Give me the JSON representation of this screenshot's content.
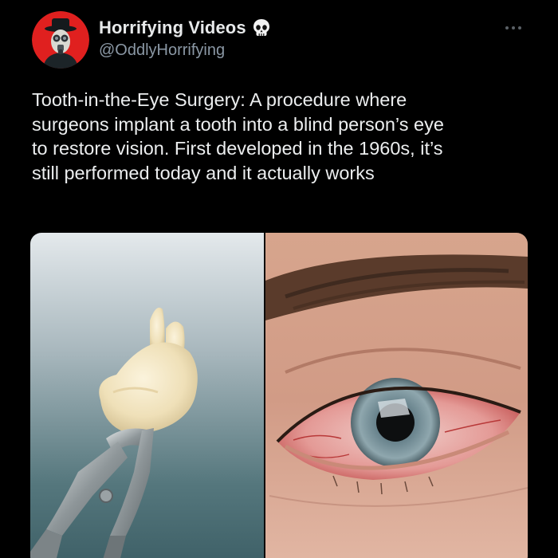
{
  "account": {
    "display_name": "Horrifying Videos",
    "handle": "@OddlyHorrifying",
    "badge_icon": "skull-icon",
    "avatar_icon": "masked-figure-avatar"
  },
  "post": {
    "text": "Tooth-in-the-Eye Surgery: A procedure where\nsurgeons implant a tooth into a blind person’s eye\nto restore vision. First developed in the 1960s, it’s\nstill performed today and it actually works"
  },
  "media": {
    "left_image": "tooth-held-by-dental-forceps",
    "right_image": "close-up-red-irritated-eye"
  },
  "colors": {
    "background": "#000000",
    "text_primary": "#e7e9ea",
    "text_secondary": "#8b98a5",
    "avatar_ring": "#e0201f"
  }
}
